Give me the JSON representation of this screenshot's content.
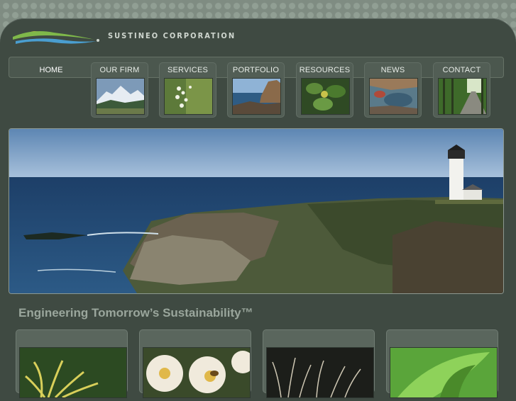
{
  "brand": {
    "company_name": "SUSTINEO CORPORATION"
  },
  "nav": {
    "items": [
      {
        "label": "HOME",
        "active": true
      },
      {
        "label": "OUR FIRM",
        "thumb": "mountain-photo"
      },
      {
        "label": "SERVICES",
        "thumb": "white-flowers-photo"
      },
      {
        "label": "PORTFOLIO",
        "thumb": "rocky-coast-photo"
      },
      {
        "label": "RESOURCES",
        "thumb": "leaves-photo"
      },
      {
        "label": "NEWS",
        "thumb": "tidepool-photo"
      },
      {
        "label": "CONTACT",
        "thumb": "forest-road-photo"
      }
    ]
  },
  "hero": {
    "image": "lighthouse-coast-photo"
  },
  "tagline": "Engineering Tomorrow’s Sustainability™",
  "cards": [
    {
      "image": "yellow-plant-photo"
    },
    {
      "image": "white-flowers-bee-photo"
    },
    {
      "image": "dry-grass-photo"
    },
    {
      "image": "green-leaf-photo"
    }
  ],
  "colors": {
    "panel": "#3f4a42",
    "background": "#7f8c82",
    "tagline": "#9aa69c",
    "nav_text": "#e7ece7"
  }
}
